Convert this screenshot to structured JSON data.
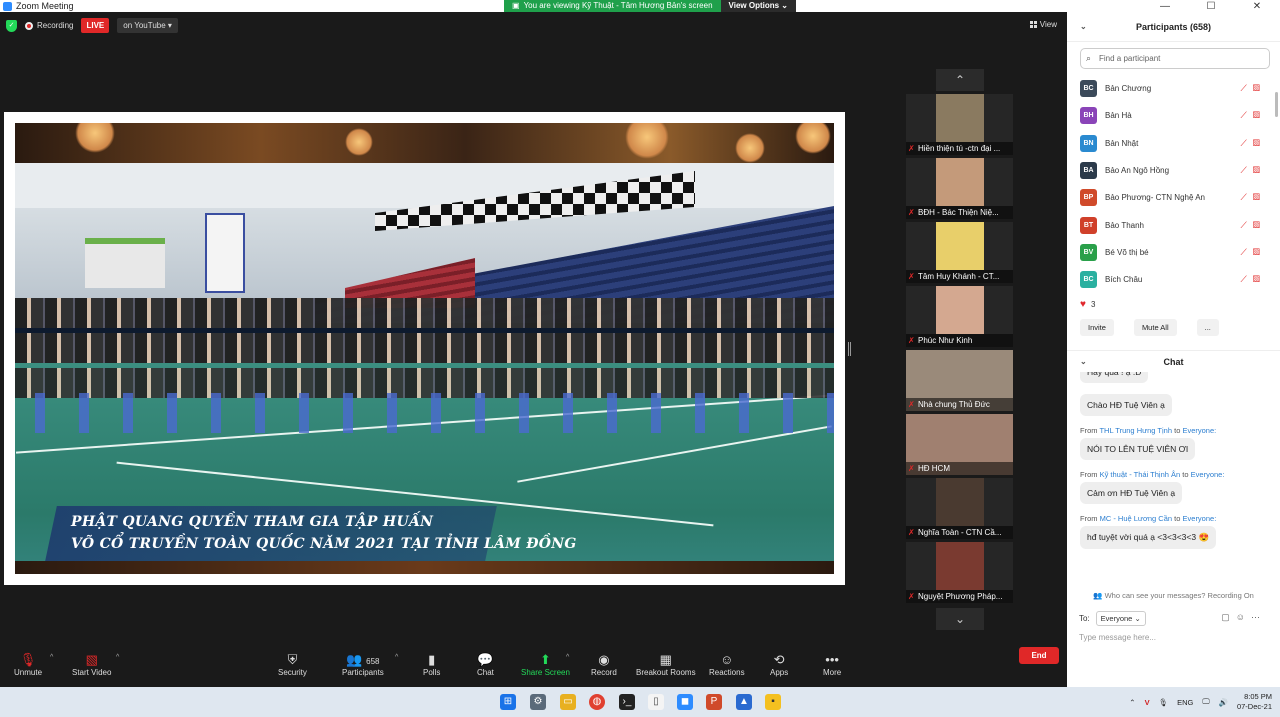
{
  "window": {
    "title": "Zoom Meeting",
    "controls": [
      "—",
      "☐",
      "✕"
    ]
  },
  "share_banner": {
    "text": "You are viewing Kỹ Thuật - Tâm Hương Bản's screen",
    "options": "View Options"
  },
  "status": {
    "recording": "Recording",
    "live": "LIVE",
    "platform": "on YouTube"
  },
  "view_label": "View",
  "shared_content": {
    "caption_line1": "PHẬT QUANG QUYỀN THAM GIA TẬP HUẤN",
    "caption_line2": "VÕ CỔ TRUYỀN TOÀN QUỐC NĂM 2021 TẠI TỈNH LÂM ĐỒNG"
  },
  "gallery": [
    {
      "name": "Hiền thiện tú -ctn đại ...",
      "color": "#8a7a60"
    },
    {
      "name": "BĐH - Bác Thiện Niệ...",
      "color": "#c49a7a"
    },
    {
      "name": "Tâm Huy Khánh - CT...",
      "color": "#e8cf6a"
    },
    {
      "name": "Phúc Như Kinh",
      "color": "#d4a890"
    },
    {
      "name": "Nhà chung Thủ Đức",
      "color": "#9a8a7a"
    },
    {
      "name": "HĐ HCM",
      "color": "#a08070"
    },
    {
      "name": "Nghĩa Toàn - CTN Cầ...",
      "color": "#4a3a30"
    },
    {
      "name": "Nguyệt Phương Pháp...",
      "color": "#7a3a30"
    }
  ],
  "toolbar": {
    "unmute": "Unmute",
    "start_video": "Start Video",
    "security": "Security",
    "participants": "Participants",
    "participants_count": "658",
    "polls": "Polls",
    "chat": "Chat",
    "share_screen": "Share Screen",
    "record": "Record",
    "breakout": "Breakout Rooms",
    "reactions": "Reactions",
    "apps": "Apps",
    "more": "More",
    "end": "End"
  },
  "participants_panel": {
    "title": "Participants (658)",
    "search_placeholder": "Find a participant",
    "list": [
      {
        "initials": "BC",
        "name": "Bản Chương",
        "color": "#3b4a5a"
      },
      {
        "initials": "BH",
        "name": "Bản Hà",
        "color": "#8a44b8"
      },
      {
        "initials": "BN",
        "name": "Bản Nhật",
        "color": "#2a8ad0"
      },
      {
        "initials": "BA",
        "name": "Bảo An Ngô Hồng",
        "color": "#2b3a4a"
      },
      {
        "initials": "BP",
        "name": "Bảo Phương- CTN Nghệ An",
        "color": "#d04a2a"
      },
      {
        "initials": "BT",
        "name": "Bảo Thanh",
        "color": "#d0402a"
      },
      {
        "initials": "BV",
        "name": "Bé Võ thị bé",
        "color": "#2aa04a"
      },
      {
        "initials": "BC",
        "name": "Bích Châu",
        "color": "#2ab0a0"
      }
    ],
    "reaction_count": "3",
    "invite": "Invite",
    "mute_all": "Mute All",
    "more": "..."
  },
  "chat_panel": {
    "title": "Chat",
    "messages": [
      {
        "type": "bubble",
        "text": "Hay quá ! ạ :D"
      },
      {
        "type": "bubble",
        "text": "Chào HĐ Tuệ Viên ạ"
      },
      {
        "type": "from",
        "prefix": "From",
        "sender": "THL Trung Hưng Tịnh",
        "to": "to",
        "target": "Everyone:"
      },
      {
        "type": "bubble",
        "text": "NÓI TO LÊN TUỆ VIÊN ƠI"
      },
      {
        "type": "from",
        "prefix": "From",
        "sender": "Kỹ thuật - Thái Thịnh Ân",
        "to": "to",
        "target": "Everyone:"
      },
      {
        "type": "bubble",
        "text": "Cảm ơn HĐ Tuệ Viên ạ"
      },
      {
        "type": "from",
        "prefix": "From",
        "sender": "MC - Huệ Lương Cần",
        "to": "to",
        "target": "Everyone:"
      },
      {
        "type": "bubble",
        "text": "hđ tuyệt vời quá ạ <3<3<3<3 😍"
      }
    ],
    "who_can_see": "Who can see your messages? Recording On",
    "to_label": "To:",
    "to_value": "Everyone",
    "input_placeholder": "Type message here..."
  },
  "taskbar": {
    "lang": "ENG",
    "time": "8:05 PM",
    "date": "07-Dec-21"
  }
}
